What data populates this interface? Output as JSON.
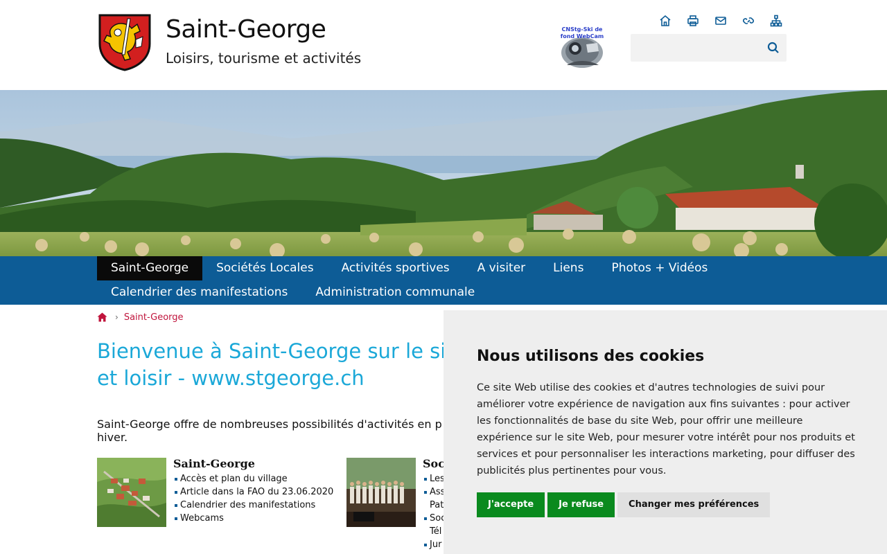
{
  "header": {
    "title": "Saint-George",
    "subtitle": "Loisirs, tourisme et activités",
    "webcam_label": "CNStg-Ski de fond WebCam",
    "tool_icons": [
      "home-icon",
      "print-icon",
      "mail-icon",
      "link-icon",
      "sitemap-icon"
    ],
    "search_value": ""
  },
  "nav": {
    "row1": [
      "Saint-George",
      "Sociétés Locales",
      "Activités sportives",
      "A visiter",
      "Liens",
      "Photos + Vidéos"
    ],
    "row2": [
      "Calendrier des manifestations",
      "Administration communale"
    ]
  },
  "breadcrumb": {
    "current": "Saint-George"
  },
  "main": {
    "title": "Bienvenue à Saint-George sur le site d",
    "title_line2": "et loisir - www.stgeorge.ch",
    "intro": "Saint-George offre de nombreuses possibilités d'activités en p",
    "intro_line2": "hiver.",
    "card1": {
      "title": "Saint-George",
      "links": [
        "Accès et plan du village",
        "Article dans la FAO du 23.06.2020",
        "Calendrier des manifestations",
        "Webcams"
      ]
    },
    "card2": {
      "title": "Soc",
      "links": [
        "Les",
        "Ass",
        "Pat",
        "Soc",
        "Tél",
        "Jur"
      ]
    }
  },
  "cookie": {
    "title": "Nous utilisons des cookies",
    "text": "Ce site Web utilise des cookies et d'autres technologies de suivi pour améliorer votre expérience de navigation aux fins suivantes : pour activer les fonctionnalités de base du site Web, pour offrir une meilleure expérience sur le site Web, pour mesurer votre intérêt pour nos produits et services et pour personnaliser les interactions marketing, pour diffuser des publicités plus pertinentes pour vous.",
    "accept": "J'accepte",
    "refuse": "Je refuse",
    "preferences": "Changer mes préférences"
  },
  "colors": {
    "nav_bg": "#0d5c96",
    "title_blue": "#1ba8d8",
    "breadcrumb_red": "#c0143c",
    "button_green": "#0a8a1e"
  }
}
